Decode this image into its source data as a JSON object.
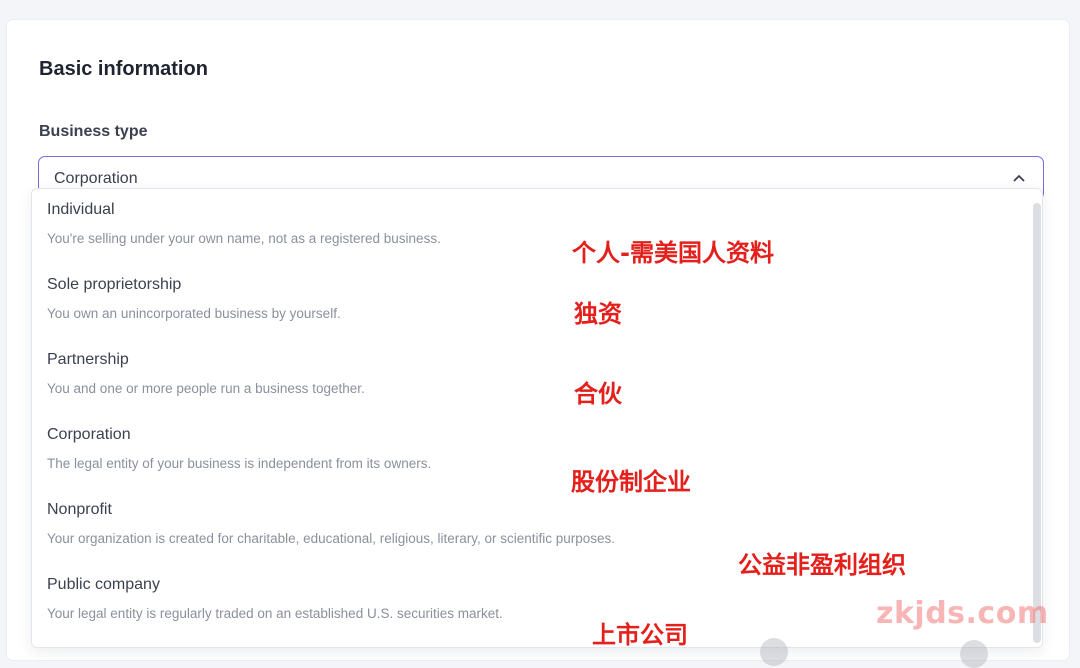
{
  "section": {
    "title": "Basic information"
  },
  "business_type": {
    "label": "Business type",
    "selected": "Corporation"
  },
  "options": [
    {
      "title": "Individual",
      "description": "You're selling under your own name, not as a registered business.",
      "annotation": "个人-需美国人资料"
    },
    {
      "title": "Sole proprietorship",
      "description": "You own an unincorporated business by yourself.",
      "annotation": "独资"
    },
    {
      "title": "Partnership",
      "description": "You and one or more people run a business together.",
      "annotation": "合伙"
    },
    {
      "title": "Corporation",
      "description": "The legal entity of your business is independent from its owners.",
      "annotation": "股份制企业"
    },
    {
      "title": "Nonprofit",
      "description": "Your organization is created for charitable, educational, religious, literary, or scientific purposes.",
      "annotation": "公益非盈利组织"
    },
    {
      "title": "Public company",
      "description": "Your legal entity is regularly traded on an established U.S. securities market.",
      "annotation": "上市公司"
    }
  ],
  "icons": {
    "select_toggle": "chevron-up-icon"
  },
  "watermark": "zkjds.com",
  "colors": {
    "focus_border": "#7b6cd9",
    "annotation": "#e3201b",
    "watermark": "#f07878"
  }
}
